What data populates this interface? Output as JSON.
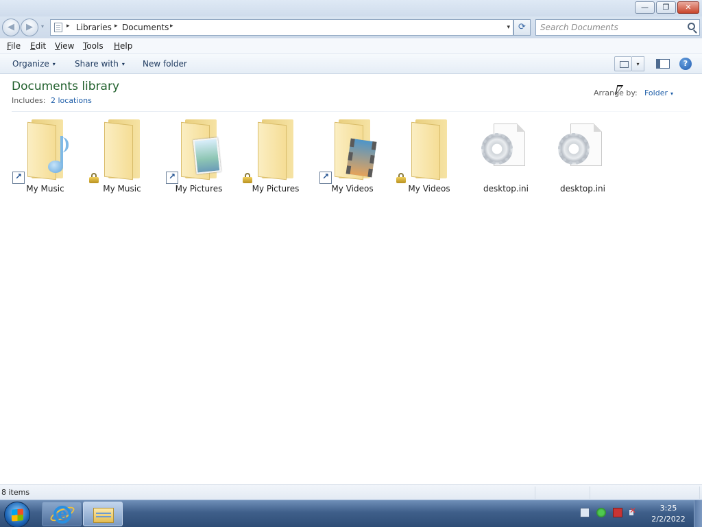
{
  "window": {
    "min_glyph": "—",
    "max_glyph": "❐",
    "close_glyph": "✕"
  },
  "navigation": {
    "back_glyph": "◀",
    "forward_glyph": "▶",
    "breadcrumb": [
      "Libraries",
      "Documents"
    ],
    "separator": "▸",
    "dropdown_glyph": "▾",
    "refresh_glyph": "⟳"
  },
  "search": {
    "placeholder": "Search Documents"
  },
  "menubar": {
    "items": [
      {
        "underline": "F",
        "rest": "ile"
      },
      {
        "underline": "E",
        "rest": "dit"
      },
      {
        "underline": "V",
        "rest": "iew"
      },
      {
        "underline": "T",
        "rest": "ools"
      },
      {
        "underline": "H",
        "rest": "elp"
      }
    ]
  },
  "commandbar": {
    "organize": "Organize",
    "share_with": "Share with",
    "new_folder": "New folder",
    "caret": "▾",
    "help": "?"
  },
  "library": {
    "title": "Documents library",
    "includes_label": "Includes:",
    "includes_link": "2 locations",
    "arrange_label": "Arrange by:",
    "arrange_value": "Folder"
  },
  "items": [
    {
      "label": "My Music",
      "kind": "folder",
      "overlay": "music-note",
      "badge": "shortcut"
    },
    {
      "label": "My Music",
      "kind": "folder",
      "overlay": "none",
      "badge": "lock"
    },
    {
      "label": "My Pictures",
      "kind": "folder",
      "overlay": "picture",
      "badge": "shortcut"
    },
    {
      "label": "My Pictures",
      "kind": "folder",
      "overlay": "none",
      "badge": "lock"
    },
    {
      "label": "My Videos",
      "kind": "folder",
      "overlay": "film",
      "badge": "shortcut"
    },
    {
      "label": "My Videos",
      "kind": "folder",
      "overlay": "none",
      "badge": "lock"
    },
    {
      "label": "desktop.ini",
      "kind": "settings-file",
      "overlay": "gear",
      "badge": "none"
    },
    {
      "label": "desktop.ini",
      "kind": "settings-file",
      "overlay": "gear",
      "badge": "none"
    }
  ],
  "statusbar": {
    "text": "8 items"
  },
  "taskbar": {
    "time": "3:25",
    "date": "2/2/2022"
  }
}
